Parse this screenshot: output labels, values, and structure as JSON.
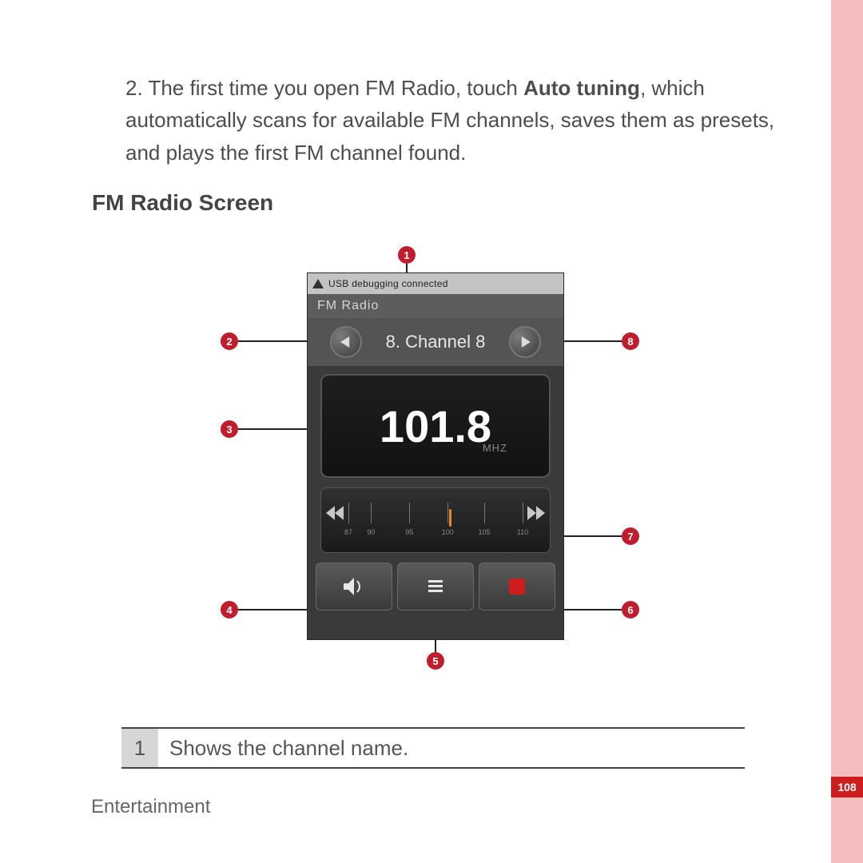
{
  "step": {
    "number": "2.",
    "pre": "The first time you open FM Radio, touch ",
    "bold": "Auto tuning",
    "post": ", which automatically scans for available FM channels, saves them as presets, and plays the first FM channel found."
  },
  "heading": "FM Radio Screen",
  "phone": {
    "status": "USB debugging connected",
    "title": "FM Radio",
    "channel": "8. Channel 8",
    "frequency": "101.8",
    "unit": "MHZ",
    "dial_labels": [
      "87",
      "90",
      "95",
      "100",
      "105",
      "110"
    ]
  },
  "callouts": [
    "1",
    "2",
    "3",
    "4",
    "5",
    "6",
    "7",
    "8"
  ],
  "legend": {
    "num": "1",
    "text": "Shows the channel name."
  },
  "footer": {
    "section": "Entertainment",
    "page": "108"
  }
}
